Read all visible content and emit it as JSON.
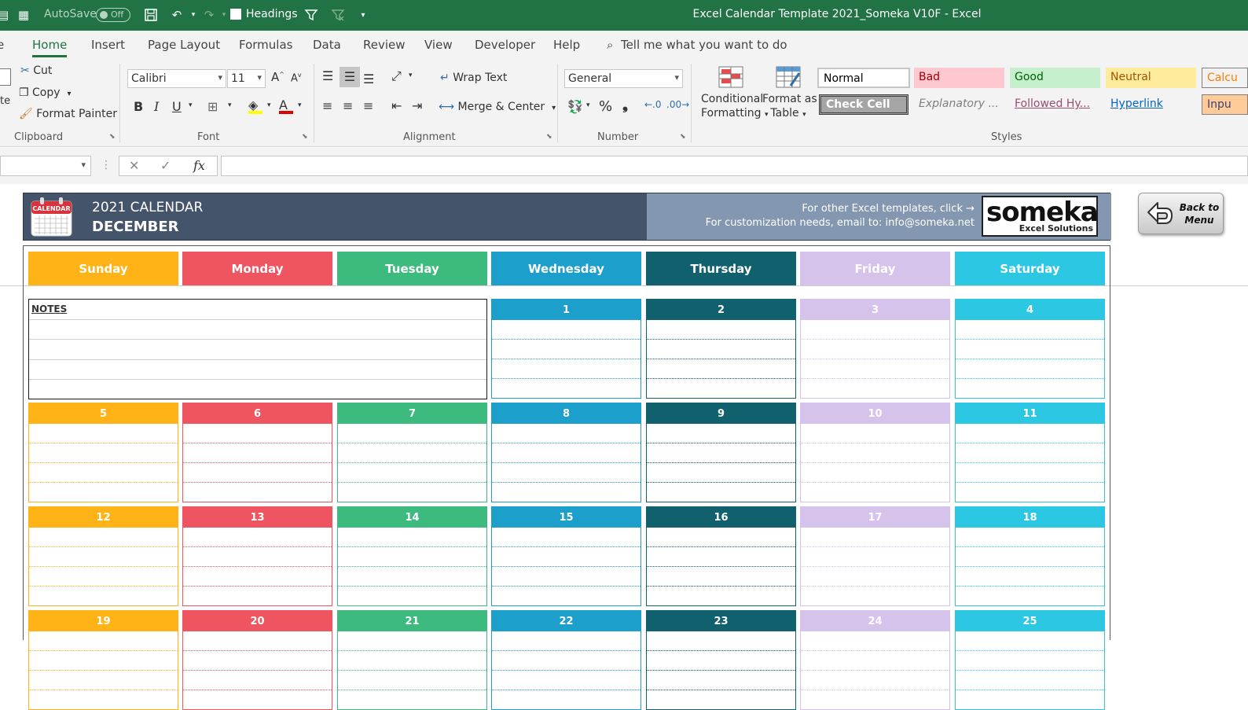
{
  "window": {
    "title": "Excel Calendar Template 2021_Someka V10F  -  Excel",
    "autosave_label": "AutoSave",
    "autosave_state": "Off",
    "headings_label": "Headings",
    "theme_color": "#217346"
  },
  "ribbon_tabs": [
    "Home",
    "Insert",
    "Page Layout",
    "Formulas",
    "Data",
    "Review",
    "View",
    "Developer",
    "Help"
  ],
  "tell_me": "Tell me what you want to do",
  "clipboard": {
    "cut": "Cut",
    "copy": "Copy",
    "format_painter": "Format Painter",
    "paste_partial": "te",
    "group": "Clipboard"
  },
  "font": {
    "name": "Calibri",
    "size": "11",
    "bold": "B",
    "italic": "I",
    "underline": "U",
    "grow": "A",
    "shrink": "A",
    "color_letter": "A",
    "group": "Font"
  },
  "alignment": {
    "wrap_text": "Wrap Text",
    "merge_center": "Merge & Center",
    "group": "Alignment"
  },
  "number": {
    "format": "General",
    "percent": "%",
    "comma": "❟",
    "group": "Number"
  },
  "styles": {
    "conditional_1": "Conditional",
    "conditional_2": "Formatting",
    "format_table_1": "Format as",
    "format_table_2": "Table",
    "cells": [
      {
        "label": "Normal",
        "bg": "#ffffff",
        "fg": "#000000"
      },
      {
        "label": "Bad",
        "bg": "#ffc7ce",
        "fg": "#9c0006"
      },
      {
        "label": "Good",
        "bg": "#c6efce",
        "fg": "#006100"
      },
      {
        "label": "Neutral",
        "bg": "#ffeb9c",
        "fg": "#9c5700"
      },
      {
        "label": "Calcu",
        "bg": "#f2f2f2",
        "fg": "#fa7d00"
      },
      {
        "label": "Check Cell",
        "bg": "#a5a5a5",
        "fg": "#ffffff"
      },
      {
        "label": "Explanatory ...",
        "bg": "#f3f3f3",
        "fg": "#7f7f7f"
      },
      {
        "label": "Followed Hy...",
        "bg": "#f3f3f3",
        "fg": "#954f72"
      },
      {
        "label": "Hyperlink",
        "bg": "#f3f3f3",
        "fg": "#0563c1"
      },
      {
        "label": "Inpu",
        "bg": "#ffcc99",
        "fg": "#3f3f76"
      }
    ],
    "group": "Styles"
  },
  "formula_bar": {
    "name_box": "",
    "fx": "fx",
    "content": ""
  },
  "calendar": {
    "year_title": "2021 CALENDAR",
    "month": "DECEMBER",
    "info_line1": "For other Excel templates, click →",
    "info_line2": "For customization needs, email to: info@someka.net",
    "logo_label": "CALENDAR",
    "brand": "someka",
    "brand_sub": "Excel Solutions",
    "back_button": "Back to Menu",
    "notes_label": "NOTES",
    "days": [
      {
        "name": "Sunday",
        "color": "#ffb316"
      },
      {
        "name": "Monday",
        "color": "#ef5561"
      },
      {
        "name": "Tuesday",
        "color": "#3dba7e"
      },
      {
        "name": "Wednesday",
        "color": "#1d9fcc"
      },
      {
        "name": "Thursday",
        "color": "#11606d"
      },
      {
        "name": "Friday",
        "color": "#d6c3ec"
      },
      {
        "name": "Saturday",
        "color": "#2bc7e3"
      }
    ],
    "weeks": [
      [
        "",
        "",
        "",
        "1",
        "2",
        "3",
        "4"
      ],
      [
        "5",
        "6",
        "7",
        "8",
        "9",
        "10",
        "11"
      ],
      [
        "12",
        "13",
        "14",
        "15",
        "16",
        "17",
        "18"
      ],
      [
        "19",
        "20",
        "21",
        "22",
        "23",
        "24",
        "25"
      ]
    ]
  }
}
